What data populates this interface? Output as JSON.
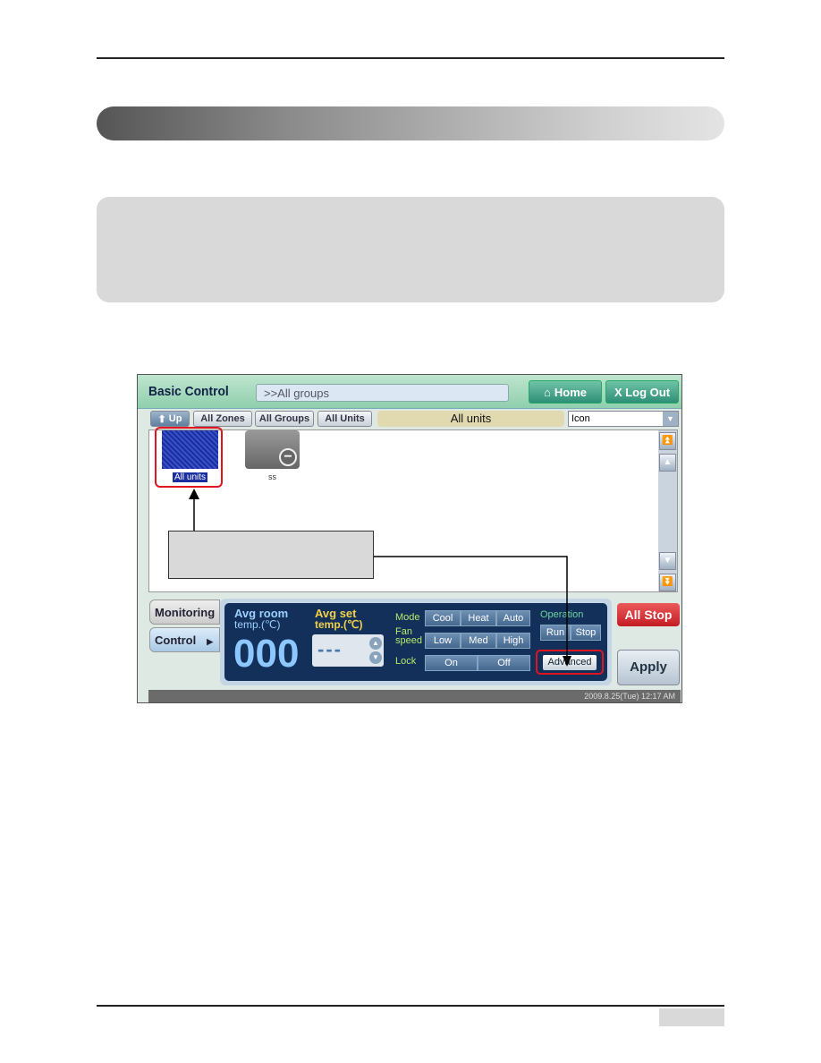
{
  "app": {
    "title": "Basic Control",
    "path": ">>All groups",
    "home_label": "Home",
    "logout_label": "X Log Out",
    "toolbar": {
      "up": "Up",
      "all_zones": "All Zones",
      "all_groups": "All Groups",
      "all_units": "All Units",
      "current": "All units",
      "view_select": "Icon"
    },
    "items": [
      {
        "label": "All units",
        "selected": true
      },
      {
        "label": "ss",
        "selected": false
      }
    ],
    "tabs": [
      {
        "label": "Monitoring"
      },
      {
        "label": "Control",
        "active": true
      }
    ],
    "panel": {
      "avg_room": "Avg room",
      "avg_room_unit": "temp.(℃)",
      "avg_room_value": "000",
      "avg_set": "Avg set",
      "avg_set_unit": "temp.(℃)",
      "avg_set_value": "---",
      "mode_label": "Mode",
      "modes": [
        "Cool",
        "Heat",
        "Auto"
      ],
      "fan_label_1": "Fan",
      "fan_label_2": "speed",
      "fans": [
        "Low",
        "Med",
        "High"
      ],
      "lock_label": "Lock",
      "locks": [
        "On",
        "Off"
      ],
      "operation_label": "Operation",
      "run": "Run",
      "stop": "Stop",
      "advanced": "Advanced"
    },
    "all_stop": "All Stop",
    "apply": "Apply",
    "status_time": "2009.8.25(Tue)  12:17 AM",
    "highlight_color": "#e0141e"
  }
}
